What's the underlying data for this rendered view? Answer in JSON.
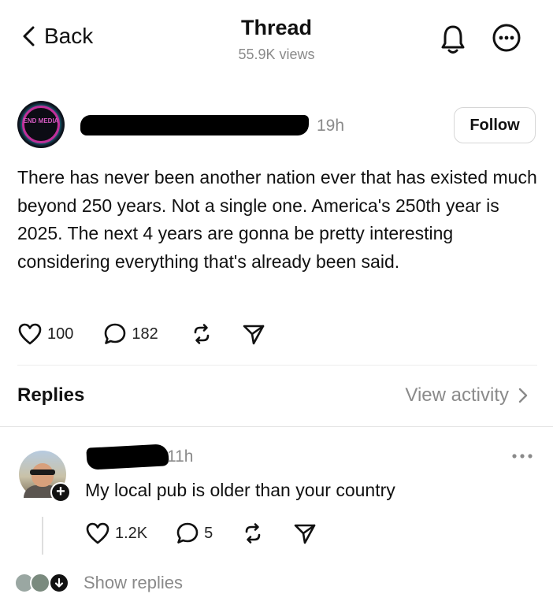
{
  "header": {
    "back_label": "Back",
    "title": "Thread",
    "views": "55.9K views"
  },
  "post": {
    "avatar_text": "END MEDIA",
    "time": "19h",
    "follow_label": "Follow",
    "text": "There has never been another nation ever that has existed much beyond 250 years. Not a single one. America's 250th year is 2025. The next 4 years are gonna be pretty interesting considering everything that's already been said.",
    "likes": "100",
    "comments": "182"
  },
  "replies_section": {
    "title": "Replies",
    "view_activity": "View activity"
  },
  "reply": {
    "time": "11h",
    "text": "My local pub is older than your country",
    "likes": "1.2K",
    "comments": "5",
    "show_replies": "Show replies"
  },
  "icons": {
    "back": "chevron-left-icon",
    "notifications": "bell-icon",
    "more": "more-horizontal-circle-icon",
    "like": "heart-icon",
    "comment": "comment-bubble-icon",
    "repost": "repost-icon",
    "share": "send-icon",
    "add": "plus-icon",
    "expand": "arrow-down-icon"
  },
  "colors": {
    "text": "#111111",
    "secondary": "#8a8a8a",
    "divider": "#ececec",
    "background": "#ffffff"
  }
}
